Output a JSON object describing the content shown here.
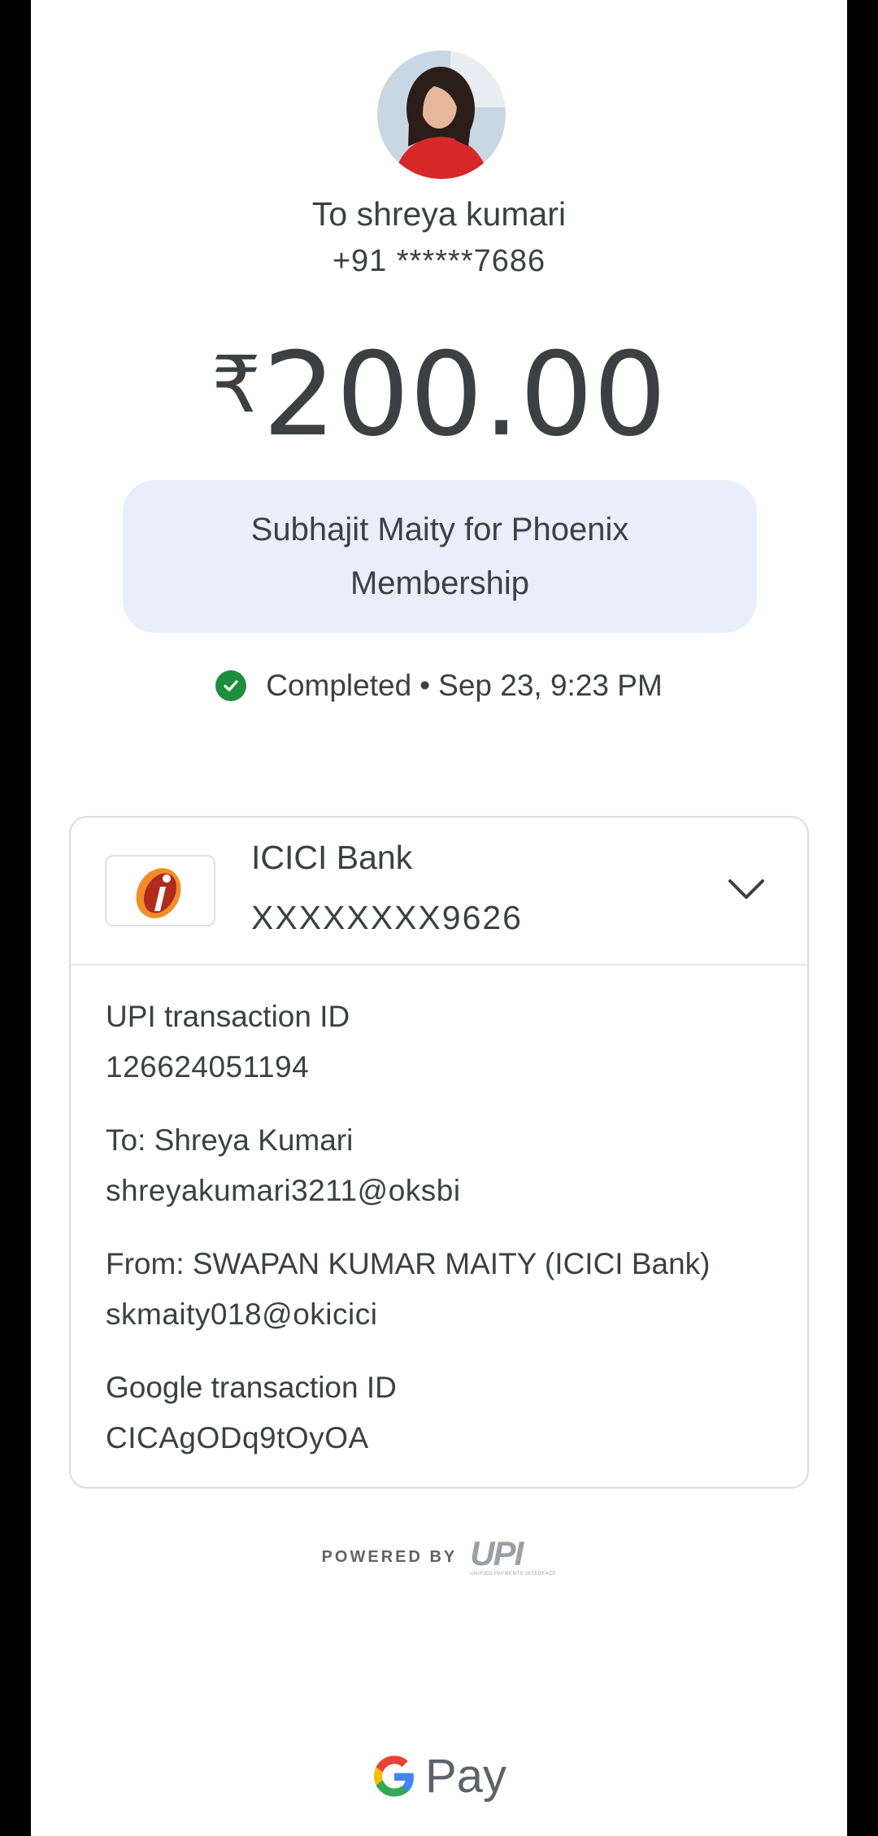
{
  "recipient": {
    "name_line": "To shreya kumari",
    "phone": "+91 ******7686"
  },
  "payment": {
    "currency_symbol": "₹",
    "amount": "200.00",
    "note": "Subhajit Maity for Phoenix Membership"
  },
  "status": {
    "label": "Completed",
    "separator": "•",
    "datetime": "Sep 23, 9:23 PM",
    "color": "#1e8e3e"
  },
  "bank": {
    "logo_icon": "icici-logo-icon",
    "name": "ICICI Bank",
    "account": "XXXXXXXX9626",
    "expand_icon": "chevron-down-icon"
  },
  "details": {
    "upi_id_label": "UPI transaction ID",
    "upi_id_value": "126624051194",
    "to_label": "To: Shreya  Kumari",
    "to_value": "shreyakumari3211@oksbi",
    "from_label": "From: SWAPAN KUMAR MAITY (ICICI Bank)",
    "from_value": "skmaity018@okicici",
    "google_id_label": "Google transaction ID",
    "google_id_value": "CICAgODq9tOyOA"
  },
  "footer": {
    "powered_by": "POWERED BY",
    "upi_mark": "UPI",
    "upi_sub": "UNIFIED PAYMENTS INTERFACE",
    "brand": "Pay"
  },
  "colors": {
    "note_bg": "#e8effa",
    "text": "#3c4043",
    "divider": "#dadce0"
  }
}
